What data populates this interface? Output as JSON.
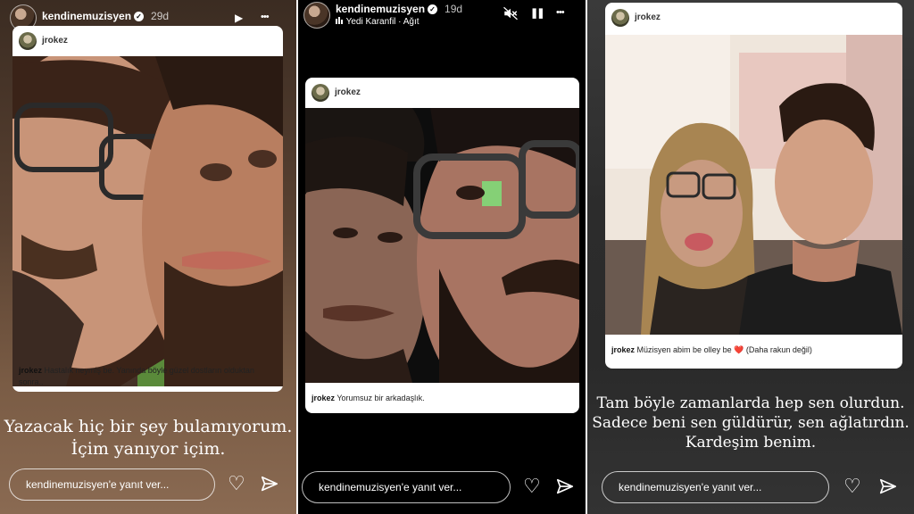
{
  "stories": [
    {
      "header": {
        "username": "kendinemuzisyen",
        "time": "29d"
      },
      "card": {
        "author": "jrokez",
        "caption_user": "jrokez",
        "caption_text": "Hastalık neymiş be. Yanında böyle güzel dostların olduktan sonra.."
      },
      "overlay_text": [
        "Yazacak hiç bir şey bulamıyorum.",
        "İçim yanıyor içim."
      ],
      "reply_placeholder": "kendinemuzisyen'e yanıt ver..."
    },
    {
      "header": {
        "username": "kendinemuzisyen",
        "time": "19d",
        "song": "Yedi Karanfil",
        "song_sep": "·",
        "song_artist": "Ağıt"
      },
      "card": {
        "author": "jrokez",
        "caption_user": "jrokez",
        "caption_text": "Yorumsuz bir arkadaşlık."
      },
      "reply_placeholder": "kendinemuzisyen'e yanıt ver..."
    },
    {
      "card": {
        "author": "jrokez",
        "caption_user": "jrokez",
        "caption_text": "Müzisyen abim be olley be",
        "caption_emoji": "❤️",
        "caption_paren": "(Daha rakun değil)"
      },
      "overlay_text": [
        "Tam böyle zamanlarda hep sen olurdun.",
        "Sadece beni sen güldürür, sen ağlatırdın.",
        "Kardeşim benim."
      ],
      "reply_placeholder": "kendinemuzisyen'e yanıt ver..."
    }
  ],
  "icons": {
    "verified": "✓",
    "play": "▶",
    "pause": "❚❚",
    "more": "•••",
    "mute": "speaker-muted",
    "like": "heart",
    "share": "paper-plane",
    "music": "music-bars"
  },
  "colors": {
    "heart_red": "#e0245e"
  }
}
